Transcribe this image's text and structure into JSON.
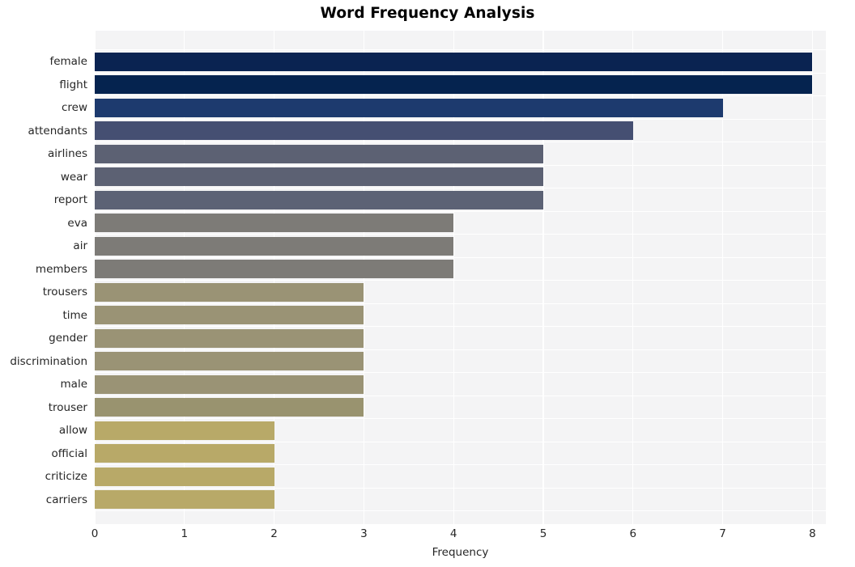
{
  "chart_data": {
    "type": "bar",
    "orientation": "horizontal",
    "title": "Word Frequency Analysis",
    "xlabel": "Frequency",
    "ylabel": "",
    "categories": [
      "female",
      "flight",
      "crew",
      "attendants",
      "airlines",
      "wear",
      "report",
      "eva",
      "air",
      "members",
      "trousers",
      "time",
      "gender",
      "discrimination",
      "male",
      "trouser",
      "allow",
      "official",
      "criticize",
      "carriers"
    ],
    "values": [
      8,
      8,
      7,
      6,
      5,
      5,
      5,
      4,
      4,
      4,
      3,
      3,
      3,
      3,
      3,
      3,
      2,
      2,
      2,
      2
    ],
    "bar_colors": [
      "#0a2351",
      "#05234f",
      "#1d3a6e",
      "#454f72",
      "#5c6173",
      "#5c6173",
      "#5c6275",
      "#7d7b77",
      "#7d7b77",
      "#7d7b77",
      "#9a9375",
      "#9a9375",
      "#9a9375",
      "#9a9375",
      "#9a9375",
      "#99936f",
      "#b8a968",
      "#b8a968",
      "#b8a968",
      "#b8a968"
    ],
    "xlim": [
      0,
      8.15
    ],
    "xticks": [
      "0",
      "1",
      "2",
      "3",
      "4",
      "5",
      "6",
      "7",
      "8"
    ],
    "xtick_values": [
      0,
      1,
      2,
      3,
      4,
      5,
      6,
      7,
      8
    ],
    "grid": true,
    "grid_color": "#ffffff",
    "plot_background": "#f4f4f5",
    "figure_background": "#ffffff",
    "legend": null,
    "style": "whitegrid"
  }
}
